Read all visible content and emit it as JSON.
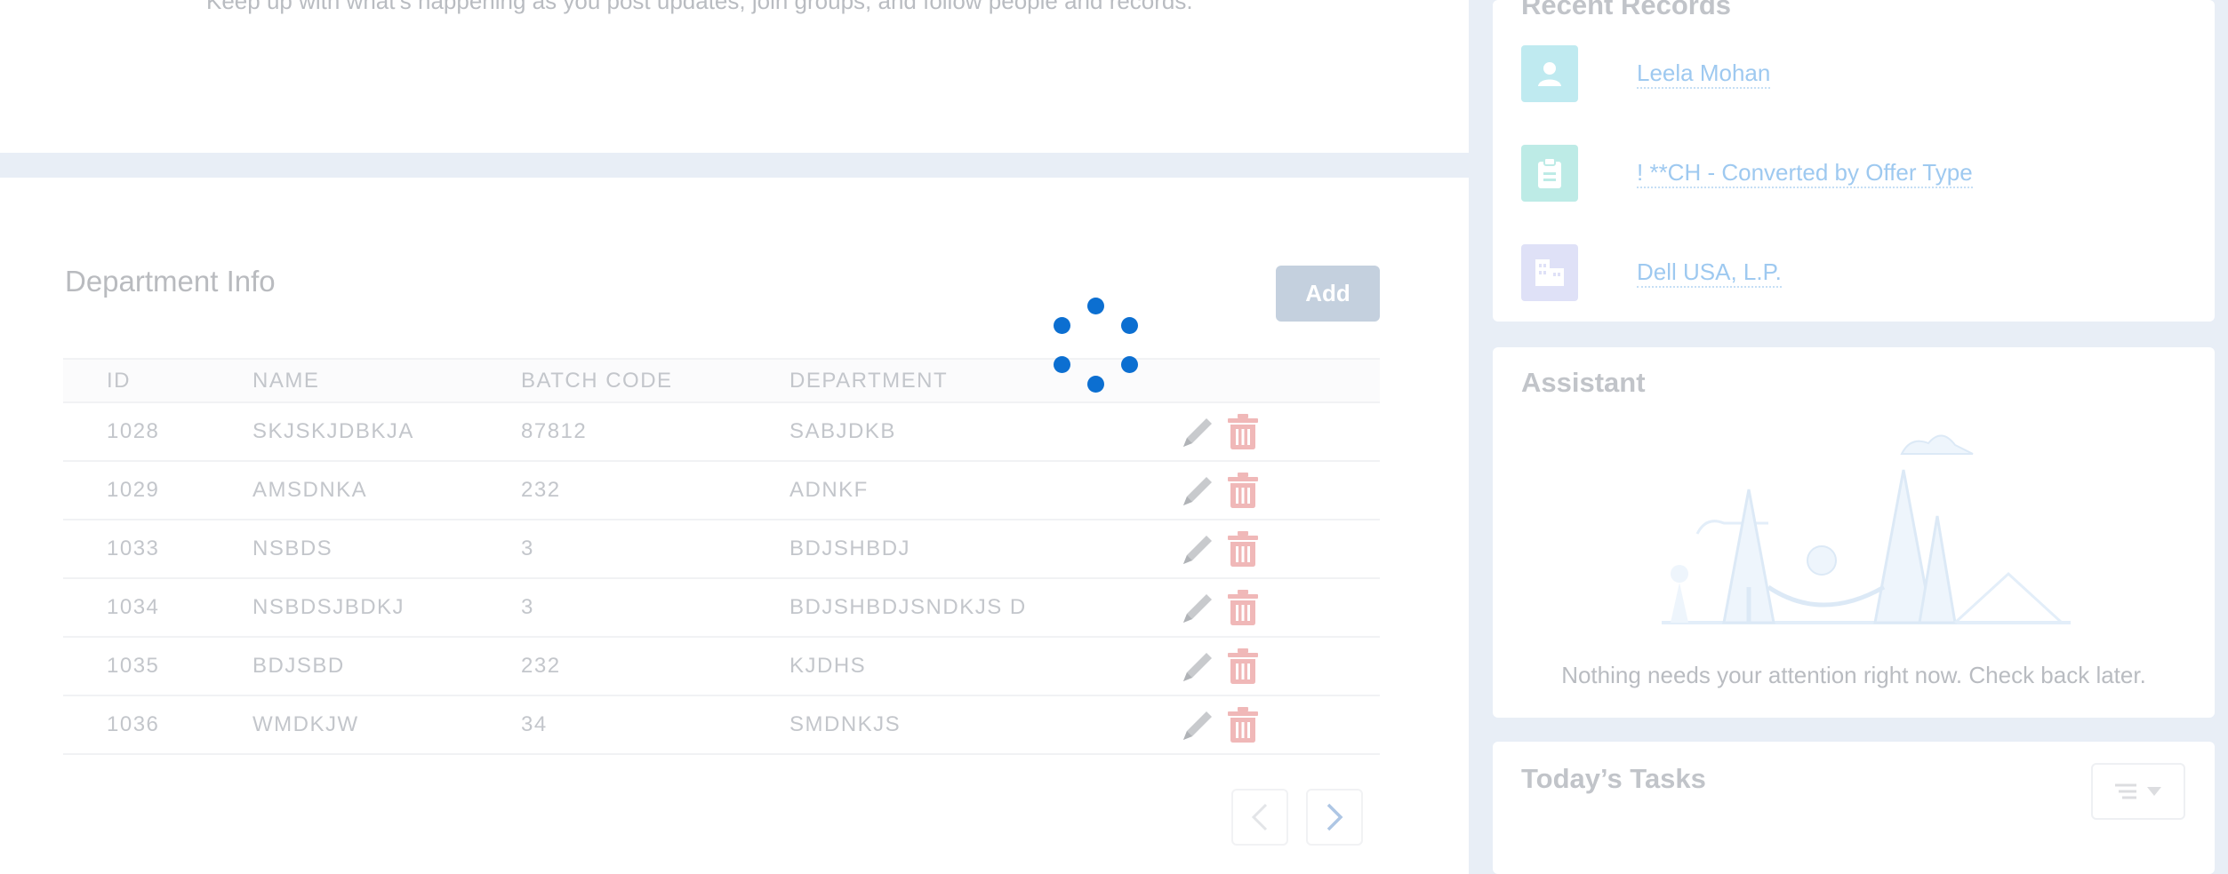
{
  "feed": {
    "description": "Keep up with what’s happening as you post updates, join groups, and follow people and records."
  },
  "department": {
    "title": "Department Info",
    "add_label": "Add",
    "columns": [
      "ID",
      "NAME",
      "BATCH CODE",
      "DEPARTMENT"
    ],
    "rows": [
      {
        "id": "1028",
        "name": "SKJSKJDBKJA",
        "batch": "87812",
        "dept": "SABJDKB"
      },
      {
        "id": "1029",
        "name": "AMSDNKA",
        "batch": "232",
        "dept": "ADNKF"
      },
      {
        "id": "1033",
        "name": "NSBDS",
        "batch": "3",
        "dept": "BDJSHBDJ"
      },
      {
        "id": "1034",
        "name": "NSBDSJBDKJ",
        "batch": "3",
        "dept": "BDJSHBDJSNDKJS D"
      },
      {
        "id": "1035",
        "name": "BDJSBD",
        "batch": "232",
        "dept": "KJDHS"
      },
      {
        "id": "1036",
        "name": "WMDKJW",
        "batch": "34",
        "dept": "SMDNKJS"
      }
    ],
    "edit_icon": "pencil-icon",
    "delete_icon": "trash-icon"
  },
  "recent_records": {
    "title": "Recent Records",
    "items": [
      {
        "label": "Leela Mohan",
        "icon": "person-icon",
        "color": "#bfeaf0"
      },
      {
        "label": "! **CH - Converted by Offer Type",
        "icon": "clipboard-icon",
        "color": "#bdebe6"
      },
      {
        "label": "Dell USA, L.P.",
        "icon": "building-icon",
        "color": "#dfe1f7"
      }
    ]
  },
  "assistant": {
    "title": "Assistant",
    "message": "Nothing needs your attention right now. Check back later."
  },
  "tasks": {
    "title": "Today’s Tasks"
  },
  "colors": {
    "spinner": "#0c6fd1",
    "delete": "#f0b8b8",
    "edit": "#c8cacd"
  }
}
